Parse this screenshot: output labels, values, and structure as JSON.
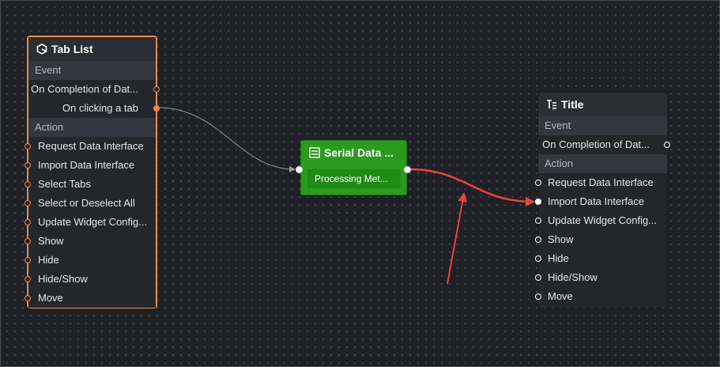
{
  "tab_list_node": {
    "title": "Tab List",
    "event_section": "Event",
    "events": [
      "On Completion of Dat...",
      "On clicking a tab"
    ],
    "action_section": "Action",
    "actions": [
      "Request Data Interface",
      "Import Data Interface",
      "Select Tabs",
      "Select or Deselect All",
      "Update Widget Config...",
      "Show",
      "Hide",
      "Hide/Show",
      "Move"
    ],
    "accent_color": "#ee8a3c"
  },
  "serial_node": {
    "title": "Serial Data ...",
    "method": "Processing Met...",
    "color": "#2b9a1e"
  },
  "title_node": {
    "title": "Title",
    "event_section": "Event",
    "events": [
      "On Completion of Dat..."
    ],
    "action_section": "Action",
    "actions": [
      "Request Data Interface",
      "Import Data Interface",
      "Update Widget Config...",
      "Show",
      "Hide",
      "Hide/Show",
      "Move"
    ]
  },
  "connections": [
    {
      "from": "Tab List.On clicking a tab",
      "to": "Serial Data ...",
      "color": "#9a9a9a"
    },
    {
      "from": "Serial Data ...",
      "to": "Title.Import Data Interface",
      "color": "#e8443a"
    }
  ],
  "annotation": {
    "type": "arrow",
    "color": "#e8443a"
  },
  "icons": {
    "tab_list": "tab-list-icon",
    "serial": "serial-data-icon",
    "title": "title-text-icon"
  }
}
